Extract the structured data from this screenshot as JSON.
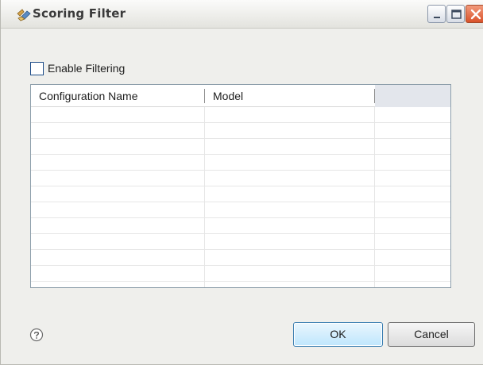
{
  "window": {
    "title": "Scoring Filter",
    "icons": [
      "app-icon",
      "minimize-icon",
      "maximize-icon",
      "close-icon"
    ]
  },
  "filter": {
    "enable_label": "Enable Filtering",
    "enabled": false
  },
  "table": {
    "columns": [
      "Configuration Name",
      "Model"
    ],
    "rows": [
      [
        "",
        ""
      ],
      [
        "",
        ""
      ],
      [
        "",
        ""
      ],
      [
        "",
        ""
      ],
      [
        "",
        ""
      ],
      [
        "",
        ""
      ],
      [
        "",
        ""
      ],
      [
        "",
        ""
      ],
      [
        "",
        ""
      ],
      [
        "",
        ""
      ],
      [
        "",
        ""
      ]
    ]
  },
  "footer": {
    "help_icon": "help-icon",
    "ok_label": "OK",
    "cancel_label": "Cancel"
  },
  "colors": {
    "button_accent": "#3c7fb1",
    "close_button": "#d9522a"
  }
}
